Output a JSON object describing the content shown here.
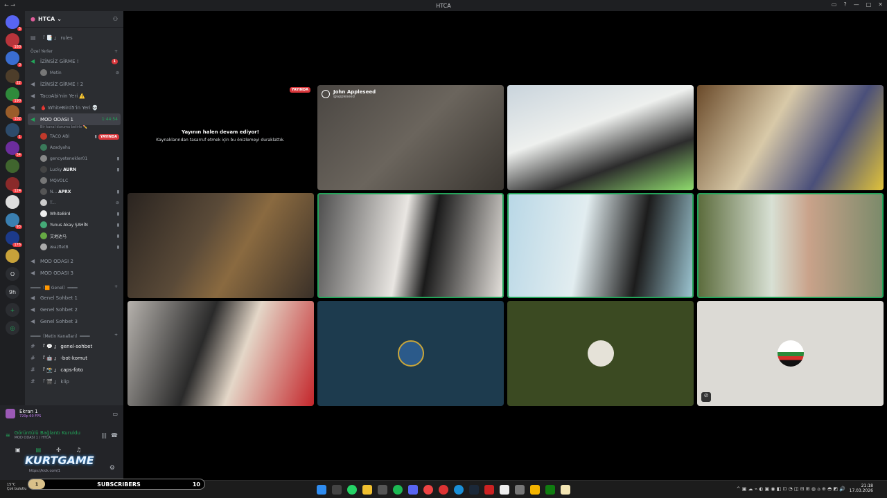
{
  "window": {
    "title": "HTCA"
  },
  "server": {
    "name": "HTCA"
  },
  "channels": [
    {
      "kind": "text",
      "label": "『 📑 』 rules"
    },
    {
      "kind": "category",
      "label": "Özel Yerler"
    },
    {
      "kind": "voice",
      "label": "İZİNSİZ GİRME !",
      "badge": "1"
    },
    {
      "kind": "user",
      "label": "Metin"
    },
    {
      "kind": "voice",
      "label": "İZİNSİZ GİRME ! 2"
    },
    {
      "kind": "voice",
      "label": "TacoAbi'nin Yeri ⚠️"
    },
    {
      "kind": "voice",
      "label": "🩸 WhiteBird5'in Yeri 💀"
    },
    {
      "kind": "voice-active",
      "label": "MOD ODASI 1",
      "time": "1:44:54",
      "status": "Bir kanal durumu belirle ✏️"
    }
  ],
  "voice_users": [
    {
      "name": "TACO ABİ",
      "live": "YAYINDA"
    },
    {
      "name": "Azadyahu"
    },
    {
      "name": "gencyetenekler01"
    },
    {
      "name": "Lucky",
      "tag": "AURN"
    },
    {
      "name": "MQVOLC"
    },
    {
      "name": "N...",
      "tag": "APRX"
    },
    {
      "name": "T..."
    },
    {
      "name": "WhiteBird"
    },
    {
      "name": "Yunus Akay ŞAHİN"
    },
    {
      "name": "艾地达马"
    },
    {
      "name": "æazfletB"
    }
  ],
  "channels2": [
    {
      "kind": "voice",
      "label": "MOD ODASI 2"
    },
    {
      "kind": "voice",
      "label": "MOD ODASI 3"
    },
    {
      "kind": "category",
      "label": "════〔🟧 Genel〕════"
    },
    {
      "kind": "voice",
      "label": "Genel Sohbet 1"
    },
    {
      "kind": "voice",
      "label": "Genel Sohbet 2"
    },
    {
      "kind": "voice",
      "label": "Genel Sohbet 3"
    },
    {
      "kind": "category",
      "label": "════〔Metin Kanalları〕════"
    },
    {
      "kind": "text",
      "label": "『 💬 』 genel-sohbet"
    },
    {
      "kind": "text",
      "label": "『 🤖 』 -bot-komut"
    },
    {
      "kind": "text",
      "label": "『 📸 』 caps-foto"
    },
    {
      "kind": "text",
      "label": "『 🎬 』 klip"
    }
  ],
  "screen_share": {
    "title": "Ekran 1",
    "sub": "720p 60 FPS"
  },
  "connection": {
    "status": "Görüntülü Bağlantı Kuruldu",
    "where": "MOD ODASI 1 / HTCA"
  },
  "overlay": {
    "brand": "KURTGAME",
    "url": "https://kick.com/1",
    "subs_label": "SUBSCRIBERS",
    "subs_count": "10",
    "subs_left": "1"
  },
  "notice": {
    "title": "Yayının halen devam ediyor!",
    "body": "Kaynaklarından tasarruf etmek için bu önizlemeyi duraklattık.",
    "live": "YAYINDA"
  },
  "card": {
    "name": "John Appleseed",
    "handle": "@appleseed"
  },
  "weather": {
    "temp": "15°C",
    "desc": "Çok bulutlu"
  },
  "clock": {
    "time": "21:18",
    "date": "17.03.2026"
  },
  "server_badges": [
    "5",
    "160",
    "3",
    "22",
    "190",
    "102",
    "1",
    "34",
    "124",
    "93",
    "176"
  ],
  "colors": {
    "speaking": "#23a55a",
    "live": "#da373c",
    "background": "#000000",
    "sidebar": "#2b2d31"
  }
}
